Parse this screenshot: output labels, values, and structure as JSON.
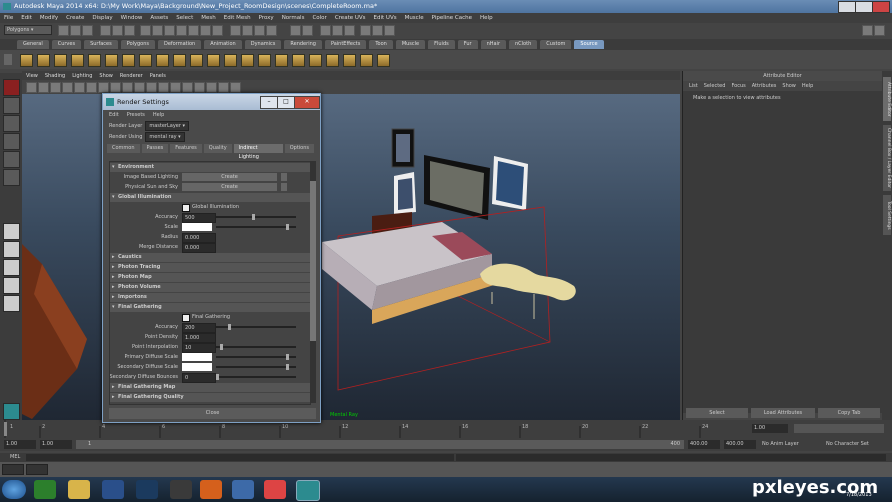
{
  "window": {
    "title": "Autodesk Maya 2014 x64: D:\\My Work\\Maya\\Background\\New_Project_RoomDesign\\scenes\\CompleteRoom.ma*"
  },
  "menubar": [
    "File",
    "Edit",
    "Modify",
    "Create",
    "Display",
    "Window",
    "Assets",
    "Select",
    "Mesh",
    "Edit Mesh",
    "Proxy",
    "Normals",
    "Color",
    "Create UVs",
    "Edit UVs",
    "Muscle",
    "Pipeline Cache",
    "Help"
  ],
  "status": {
    "module": "Polygons"
  },
  "shelf_tabs": [
    "General",
    "Curves",
    "Surfaces",
    "Polygons",
    "Deformation",
    "Animation",
    "Dynamics",
    "Rendering",
    "PaintEffects",
    "Toon",
    "Muscle",
    "Fluids",
    "Fur",
    "nHair",
    "nCloth",
    "Custom",
    "Source"
  ],
  "shelf_active": "Source",
  "viewport": {
    "menu": [
      "View",
      "Shading",
      "Lighting",
      "Show",
      "Renderer",
      "Panels"
    ],
    "hud": "Mental Ray"
  },
  "attribute_editor": {
    "title": "Attribute Editor",
    "menu": [
      "List",
      "Selected",
      "Focus",
      "Attributes",
      "Show",
      "Help"
    ],
    "message": "Make a selection to view attributes",
    "buttons": [
      "Select",
      "Load Attributes",
      "Copy Tab"
    ]
  },
  "side_tabs": [
    "Attribute Editor",
    "Channel Box / Layer Editor",
    "Tool Settings"
  ],
  "timeline": {
    "ticks": [
      "1",
      "2",
      "4",
      "6",
      "8",
      "10",
      "12",
      "14",
      "16",
      "18",
      "20",
      "22",
      "24"
    ],
    "current": "1.00"
  },
  "range": {
    "start": "1.00",
    "start2": "1.00",
    "frame": "1",
    "end_inner": "400",
    "end": "400.00",
    "end2": "400.00",
    "anim_layer": "No Anim Layer",
    "char_set": "No Character Set"
  },
  "mel": {
    "label": "MEL"
  },
  "render_settings": {
    "title": "Render Settings",
    "menu": [
      "Edit",
      "Presets",
      "Help"
    ],
    "render_layer_label": "Render Layer",
    "render_layer_value": "masterLayer",
    "render_using_label": "Render Using",
    "render_using_value": "mental ray",
    "tabs": [
      "Common",
      "Passes",
      "Features",
      "Quality",
      "Indirect Lighting",
      "Options"
    ],
    "active_tab": "Indirect Lighting",
    "environment": {
      "header": "Environment",
      "ibl_label": "Image Based Lighting",
      "ibl_button": "Create",
      "sun_label": "Physical Sun and Sky",
      "sun_button": "Create"
    },
    "gi": {
      "header": "Global Illumination",
      "checkbox": "Global Illumination",
      "accuracy_label": "Accuracy",
      "accuracy": "500",
      "scale_label": "Scale",
      "radius_label": "Radius",
      "radius": "0.000",
      "merge_label": "Merge Distance",
      "merge": "0.000"
    },
    "collapsed": [
      "Caustics",
      "Photon Tracing",
      "Photon Map",
      "Photon Volume",
      "Importons"
    ],
    "fg": {
      "header": "Final Gathering",
      "checkbox": "Final Gathering",
      "accuracy_label": "Accuracy",
      "accuracy": "200",
      "density_label": "Point Density",
      "density": "1.000",
      "interp_label": "Point Interpolation",
      "interp": "10",
      "primary_label": "Primary Diffuse Scale",
      "secondary_label": "Secondary Diffuse Scale",
      "bounces_label": "Secondary Diffuse Bounces",
      "bounces": "0"
    },
    "tail": [
      "Final Gathering Map",
      "Final Gathering Quality"
    ],
    "close": "Close"
  },
  "taskbar": {
    "date": "7/18/2013"
  },
  "watermark": "pxleyes.com",
  "colors": {
    "title_blue": "#5b7fa9",
    "active_tab": "#7898bf",
    "viewport_top": "#5c6f86",
    "viewport_bottom": "#1f2733",
    "frame_red": "#b32020"
  }
}
